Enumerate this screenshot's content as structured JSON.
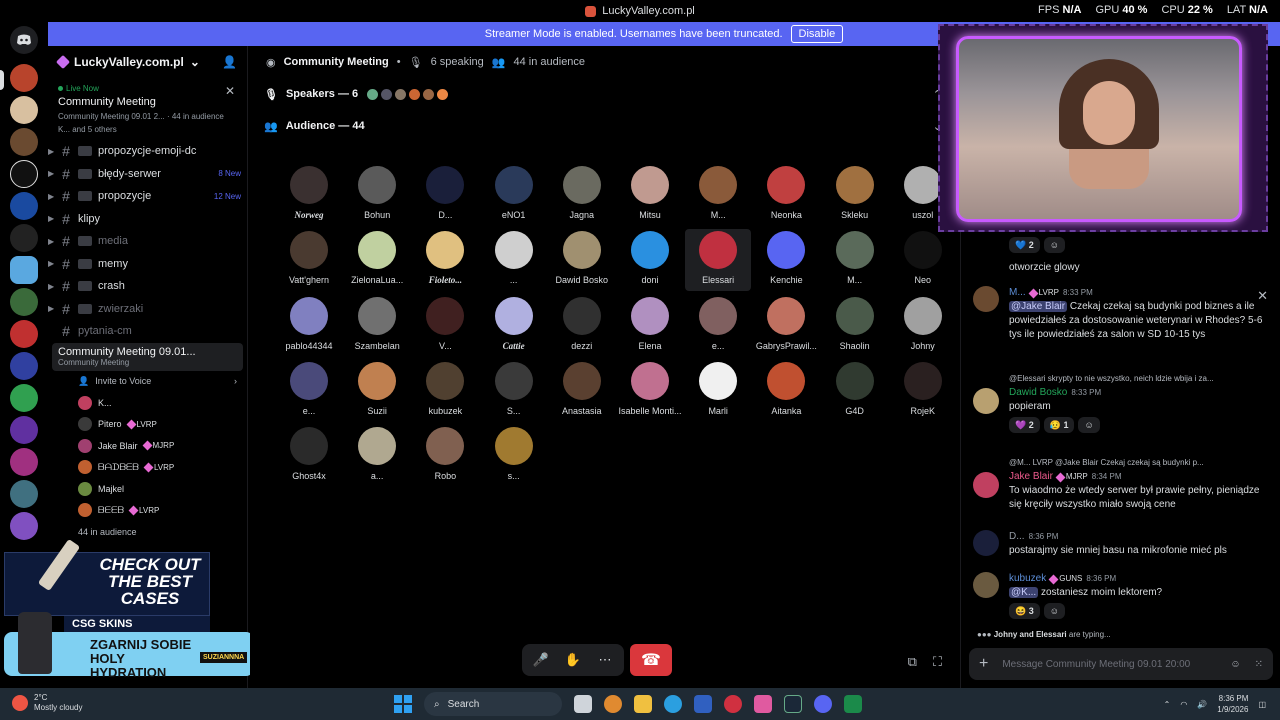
{
  "window": {
    "title": "LuckyValley.com.pl"
  },
  "overlay_stats": [
    {
      "label": "FPS",
      "value": "N/A"
    },
    {
      "label": "GPU",
      "value": "40 %"
    },
    {
      "label": "CPU",
      "value": "22 %"
    },
    {
      "label": "LAT",
      "value": "N/A"
    }
  ],
  "banner": {
    "text": "Streamer Mode is enabled. Usernames have been truncated.",
    "button": "Disable",
    "close": "✕"
  },
  "server": {
    "name": "LuckyValley.com.pl"
  },
  "live_card": {
    "status": "Live Now",
    "name": "Community Meeting",
    "meta": "Community Meeting 09.01 2...  ·  44 in audience",
    "others": "K... and 5 others"
  },
  "channels": [
    {
      "name": "propozycje-emoji-dc",
      "type": "text-emoji",
      "badge": ""
    },
    {
      "name": "błędy-serwer",
      "type": "text-emoji",
      "badge": "8 New"
    },
    {
      "name": "propozycje",
      "type": "text-emoji",
      "badge": "12 New"
    },
    {
      "name": "klipy",
      "type": "text",
      "badge": ""
    },
    {
      "name": "media",
      "type": "muted-emoji",
      "badge": ""
    },
    {
      "name": "memy",
      "type": "text-emoji",
      "badge": ""
    },
    {
      "name": "crash",
      "type": "text-emoji",
      "badge": ""
    },
    {
      "name": "zwierzaki",
      "type": "muted-emoji",
      "badge": ""
    },
    {
      "name": "pytania-cm",
      "type": "muted",
      "badge": ""
    }
  ],
  "voice_channel": {
    "name": "Community Meeting 09.01...",
    "sub": "Community Meeting",
    "invite": "Invite to Voice",
    "users": [
      {
        "name": "K...",
        "role": ""
      },
      {
        "name": "Pitero",
        "role": "LVRP"
      },
      {
        "name": "Jake Blair",
        "role": "MJRP"
      },
      {
        "name": "ᗷᗩᗪᗷᗴᗷ",
        "role": "LVRP"
      },
      {
        "name": "Majkel",
        "role": ""
      },
      {
        "name": "ᗷᗴᗴᗷ",
        "role": "LVRP"
      }
    ],
    "audience": "44 in audience"
  },
  "ad": {
    "headline": "CHECK OUT THE BEST CASES",
    "brand": "CSG SKINS",
    "promo": "ZGARNIJ SOBIE HOLY HYDRATION",
    "promo_tag": "SUZIANNNA"
  },
  "stage": {
    "title": "Community Meeting",
    "speaking": "6 speaking",
    "audience_count": "44 in audience",
    "speakers_label": "Speakers — 6",
    "audience_label": "Audience — 44",
    "audience": [
      "Norweg",
      "Bohun",
      "D...",
      "eNO1",
      "Jagna",
      "Mitsu",
      "M...",
      "Neonka",
      "Skleku",
      "uszol",
      "Vatt'ghern",
      "ZielonaLua...",
      "Fioletо...",
      "...",
      "Dawid Bosko",
      "doni",
      "Elessari",
      "Kenchie",
      "M...",
      "Neo",
      "pablo44344",
      "Szambelan",
      "V...",
      "Cattie",
      "dezzi",
      "Elena",
      "e...",
      "GabrysPrawil...",
      "Shaolin",
      "Johny",
      "e...",
      "Suzii",
      "kubuzek",
      "S...",
      "Anastasia",
      "Isabelle Monti...",
      "Marli",
      "Aitanka",
      "G4D",
      "RojeK",
      "Ghost4x",
      "a...",
      "Robo",
      "s..."
    ]
  },
  "chat": {
    "messages": [
      {
        "id": "m0",
        "text": "otworzcie glowy",
        "reacts": [
          "2"
        ]
      },
      {
        "id": "m1",
        "user": "M...",
        "role": "LVRP",
        "time": "8:33 PM",
        "mention": "@Jake Blair",
        "text": "Czekaj czekaj są budynki pod biznes a ile powiedziałeś za dostosowanie weterynari w Rhodes? 5-6 tys ile powiedziałeś za salon w SD 10-15 tys"
      },
      {
        "id": "m2",
        "reply": "@Elessari skrypty to nie wszystko, neich ldzie wbija i za...",
        "user": "Dawid Bosko",
        "time": "8:33 PM",
        "text": "popieram",
        "reacts": [
          "2",
          "1"
        ]
      },
      {
        "id": "m3",
        "reply": "@M...  LVRP  @Jake Blair Czekaj czekaj są budynki p...",
        "user": "Jake Blair",
        "role": "MJRP",
        "time": "8:34 PM",
        "text": "To wiaodmo że wtedy serwer był prawie pełny, pieniądze się kręciły wszystko miało swoją cene"
      },
      {
        "id": "m4",
        "user": "D...",
        "time": "8:36 PM",
        "text": "postarajmy sie mniej basu na mikrofonie mieć pls"
      },
      {
        "id": "m5",
        "user": "kubuzek",
        "role": "GUNS",
        "time": "8:36 PM",
        "mention": "@K...",
        "text": "zostaniesz moim lektorem?",
        "reacts": [
          "3"
        ]
      }
    ],
    "typing_users": "Johny and Elessari",
    "typing_suffix": "are typing...",
    "input_placeholder": "Message Community Meeting 09.01 20:00"
  },
  "taskbar": {
    "weather_temp": "2°C",
    "weather_desc": "Mostly cloudy",
    "search": "Search",
    "time": "8:36 PM",
    "date": "1/9/2026"
  },
  "colors": {
    "accent": "#5865f2",
    "live": "#23a55a",
    "hangup": "#da373c",
    "cam_border": "#c85bff"
  }
}
